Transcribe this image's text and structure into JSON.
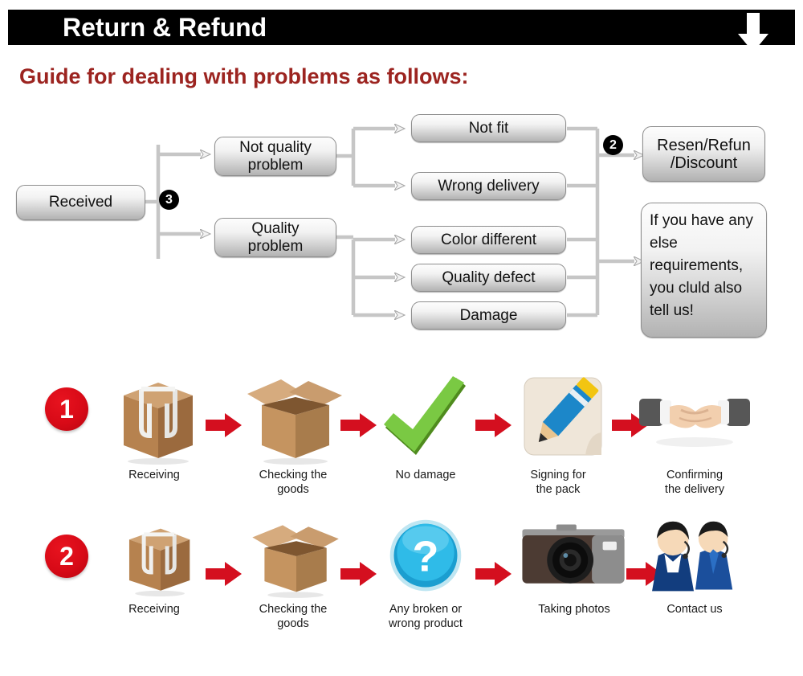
{
  "header": {
    "title": "Return & Refund",
    "arrow_icon": "arrow-down-icon",
    "bar_color": "#000000",
    "title_color": "#ffffff"
  },
  "guide": {
    "heading": "Guide for dealing with problems as follows:",
    "heading_color": "#9c2420"
  },
  "flowchart": {
    "start": {
      "label": "Received"
    },
    "badge_3": "3",
    "badge_2": "2",
    "branches": [
      {
        "label": "Not quality\nproblem",
        "line1": "Not quality",
        "line2": "problem"
      },
      {
        "label": "Quality\nproblem",
        "line1": "Quality",
        "line2": "problem"
      }
    ],
    "reasons": [
      {
        "label": "Not fit"
      },
      {
        "label": "Wrong delivery"
      },
      {
        "label": "Color different"
      },
      {
        "label": "Quality defect"
      },
      {
        "label": "Damage"
      }
    ],
    "outcomes": [
      {
        "line1": "Resen/Refun",
        "line2": "/Discount"
      },
      {
        "text": "If you have any else requirements, you cluld also tell us!"
      }
    ]
  },
  "steps": {
    "row1": {
      "number": "1",
      "items": [
        {
          "icon": "sealed-box-icon",
          "caption_line1": "Receiving",
          "caption_line2": ""
        },
        {
          "icon": "open-box-icon",
          "caption_line1": "Checking the",
          "caption_line2": "goods"
        },
        {
          "icon": "green-check-icon",
          "caption_line1": "No damage",
          "caption_line2": ""
        },
        {
          "icon": "pencil-sign-icon",
          "caption_line1": "Signing for",
          "caption_line2": "the pack"
        },
        {
          "icon": "handshake-icon",
          "caption_line1": "Confirming",
          "caption_line2": "the delivery"
        }
      ]
    },
    "row2": {
      "number": "2",
      "items": [
        {
          "icon": "sealed-box-icon",
          "caption_line1": "Receiving",
          "caption_line2": ""
        },
        {
          "icon": "open-box-icon",
          "caption_line1": "Checking the",
          "caption_line2": "goods"
        },
        {
          "icon": "blue-question-icon",
          "caption_line1": "Any broken or",
          "caption_line2": "wrong product"
        },
        {
          "icon": "camera-icon",
          "caption_line1": "Taking photos",
          "caption_line2": ""
        },
        {
          "icon": "support-agents-icon",
          "caption_line1": "Contact us",
          "caption_line2": ""
        }
      ]
    },
    "arrow_icon": "red-arrow-right-icon",
    "arrow_color": "#d40f1f",
    "number_color": "#d80a17"
  }
}
